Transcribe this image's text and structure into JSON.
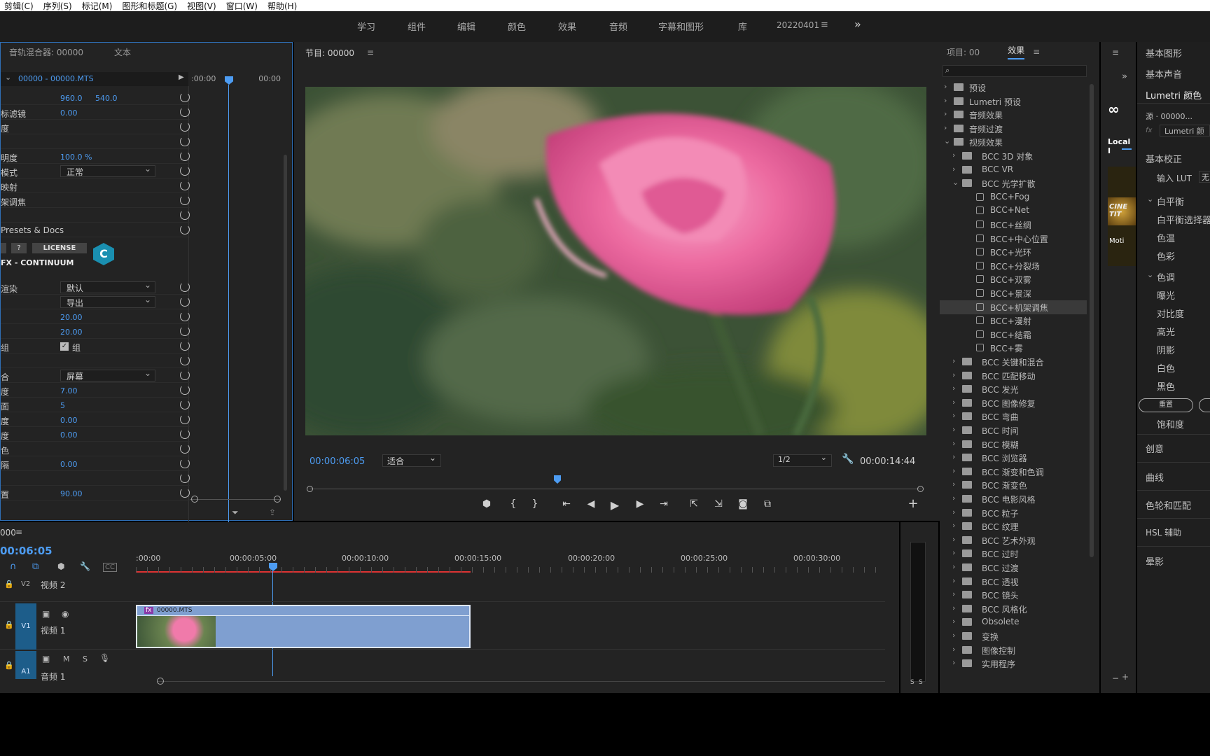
{
  "menubar": [
    "剪辑(C)",
    "序列(S)",
    "标记(M)",
    "图形和标题(G)",
    "视图(V)",
    "窗口(W)",
    "帮助(H)"
  ],
  "workspaces": {
    "tabs": [
      "学习",
      "组件",
      "编辑",
      "颜色",
      "效果",
      "音频",
      "字幕和图形",
      "库"
    ],
    "active": "20220401",
    "more": "»"
  },
  "effect_controls": {
    "tab_mixer": "音轨混合器: 00000",
    "tab_text": "文本",
    "clip_path": "00000 - 00000.MTS",
    "time_start": ":00:00",
    "time_end": "00:00",
    "rows": [
      {
        "label": "",
        "v1": "960.0",
        "v2": "540.0"
      },
      {
        "label": "标滤镜",
        "v1": "0.00"
      },
      {
        "label": "度",
        "v1": ""
      },
      {
        "label": "",
        "v1": ""
      },
      {
        "label": "明度",
        "v1": "100.0 %"
      },
      {
        "label": "模式",
        "sel": "正常"
      },
      {
        "label": "映射",
        "v1": ""
      },
      {
        "label": "架调焦",
        "v1": ""
      },
      {
        "label": "",
        "v1": ""
      },
      {
        "label": "Presets & Docs",
        "v1": ""
      }
    ],
    "license_q": "?",
    "license": "LICENSE",
    "brand": "FX - CONTINUUM",
    "brand_icon": "C",
    "rows2": [
      {
        "label": "渲染",
        "sel": "默认"
      },
      {
        "label": "",
        "sel": "导出"
      },
      {
        "label": "",
        "v1": "20.00"
      },
      {
        "label": "",
        "v1": "20.00"
      },
      {
        "label": "组",
        "check": "组"
      },
      {
        "label": "",
        "v1": ""
      },
      {
        "label": "合",
        "sel": "屏幕"
      },
      {
        "label": "度",
        "v1": "7.00"
      },
      {
        "label": "面",
        "v1": "5"
      },
      {
        "label": "度",
        "v1": "0.00"
      },
      {
        "label": "度",
        "v1": "0.00"
      },
      {
        "label": "色",
        "v1": ""
      },
      {
        "label": "隔",
        "v1": "0.00"
      },
      {
        "label": "",
        "v1": ""
      },
      {
        "label": "置",
        "v1": "90.00"
      }
    ]
  },
  "program": {
    "title": "节目: 00000",
    "timecode": "00:00:06:05",
    "fit": "适合",
    "resolution": "1/2",
    "duration": "00:00:14:44"
  },
  "project_panel": {
    "tab_project": "项目: 00",
    "tab_effects": "效果",
    "items": [
      {
        "name": "预设",
        "level": 0,
        "type": "folder",
        "open": false
      },
      {
        "name": "Lumetri 预设",
        "level": 0,
        "type": "folder",
        "open": false
      },
      {
        "name": "音频效果",
        "level": 0,
        "type": "folder",
        "open": false
      },
      {
        "name": "音频过渡",
        "level": 0,
        "type": "folder",
        "open": false
      },
      {
        "name": "视频效果",
        "level": 0,
        "type": "folder",
        "open": true
      },
      {
        "name": "BCC 3D 对象",
        "level": 1,
        "type": "folder",
        "open": false
      },
      {
        "name": "BCC VR",
        "level": 1,
        "type": "folder",
        "open": false
      },
      {
        "name": "BCC 光学扩散",
        "level": 1,
        "type": "folder",
        "open": true
      },
      {
        "name": "BCC+Fog",
        "level": 2,
        "type": "fx"
      },
      {
        "name": "BCC+Net",
        "level": 2,
        "type": "fx"
      },
      {
        "name": "BCC+丝绸",
        "level": 2,
        "type": "fx"
      },
      {
        "name": "BCC+中心位置",
        "level": 2,
        "type": "fx"
      },
      {
        "name": "BCC+光环",
        "level": 2,
        "type": "fx"
      },
      {
        "name": "BCC+分裂场",
        "level": 2,
        "type": "fx"
      },
      {
        "name": "BCC+双雾",
        "level": 2,
        "type": "fx"
      },
      {
        "name": "BCC+景深",
        "level": 2,
        "type": "fx"
      },
      {
        "name": "BCC+机架调焦",
        "level": 2,
        "type": "fx",
        "selected": true
      },
      {
        "name": "BCC+漫射",
        "level": 2,
        "type": "fx"
      },
      {
        "name": "BCC+结霜",
        "level": 2,
        "type": "fx"
      },
      {
        "name": "BCC+雾",
        "level": 2,
        "type": "fx"
      },
      {
        "name": "BCC 关键和混合",
        "level": 1,
        "type": "folder",
        "open": false
      },
      {
        "name": "BCC 匹配移动",
        "level": 1,
        "type": "folder",
        "open": false
      },
      {
        "name": "BCC 发光",
        "level": 1,
        "type": "folder",
        "open": false
      },
      {
        "name": "BCC 图像修复",
        "level": 1,
        "type": "folder",
        "open": false
      },
      {
        "name": "BCC 弯曲",
        "level": 1,
        "type": "folder",
        "open": false
      },
      {
        "name": "BCC 时间",
        "level": 1,
        "type": "folder",
        "open": false
      },
      {
        "name": "BCC 模糊",
        "level": 1,
        "type": "folder",
        "open": false
      },
      {
        "name": "BCC 浏览器",
        "level": 1,
        "type": "folder",
        "open": false
      },
      {
        "name": "BCC 渐变和色调",
        "level": 1,
        "type": "folder",
        "open": false
      },
      {
        "name": "BCC 渐变色",
        "level": 1,
        "type": "folder",
        "open": false
      },
      {
        "name": "BCC 电影风格",
        "level": 1,
        "type": "folder",
        "open": false
      },
      {
        "name": "BCC 粒子",
        "level": 1,
        "type": "folder",
        "open": false
      },
      {
        "name": "BCC 纹理",
        "level": 1,
        "type": "folder",
        "open": false
      },
      {
        "name": "BCC 艺术外观",
        "level": 1,
        "type": "folder",
        "open": false
      },
      {
        "name": "BCC 过时",
        "level": 1,
        "type": "folder",
        "open": false
      },
      {
        "name": "BCC 过渡",
        "level": 1,
        "type": "folder",
        "open": false
      },
      {
        "name": "BCC 透视",
        "level": 1,
        "type": "folder",
        "open": false
      },
      {
        "name": "BCC 镜头",
        "level": 1,
        "type": "folder",
        "open": false
      },
      {
        "name": "BCC 风格化",
        "level": 1,
        "type": "folder",
        "open": false
      },
      {
        "name": "Obsolete",
        "level": 1,
        "type": "folder",
        "open": false
      },
      {
        "name": "变换",
        "level": 1,
        "type": "folder",
        "open": false
      },
      {
        "name": "图像控制",
        "level": 1,
        "type": "folder",
        "open": false
      },
      {
        "name": "实用程序",
        "level": 1,
        "type": "folder",
        "open": false
      }
    ]
  },
  "narrow_panel": {
    "local_label": "Local I",
    "thumb_text": "CINE TIT",
    "thumb_sub": "Moti"
  },
  "right_panel": {
    "essential_graphics": "基本图形",
    "essential_sound": "基本声音",
    "lumetri": "Lumetri 颜色",
    "source": "源 · 00000...",
    "fx_label": "fx",
    "lumetri_short": "Lumetri 颜",
    "basic_correction": "基本校正",
    "input_lut": "输入 LUT",
    "lut_value": "无",
    "white_balance": "白平衡",
    "wb_selector": "白平衡选择器",
    "temperature": "色温",
    "tint": "色彩",
    "tone": "色调",
    "exposure": "曝光",
    "contrast": "对比度",
    "highlights": "高光",
    "shadows": "阴影",
    "whites": "白色",
    "blacks": "黑色",
    "reset_btn": "重置",
    "saturation": "饱和度",
    "creative": "创意",
    "curves": "曲线",
    "color_wheels": "色轮和匹配",
    "hsl": "HSL 辅助",
    "vignette": "晕影"
  },
  "timeline": {
    "seq_name": "000",
    "timecode": "00:06:05",
    "ruler": [
      ":00:00",
      "00:00:05:00",
      "00:00:10:00",
      "00:00:15:00",
      "00:00:20:00",
      "00:00:25:00",
      "00:00:30:00"
    ],
    "tracks": {
      "v2_id": "V2",
      "v2_name": "视频 2",
      "v1_id": "V1",
      "v1_name": "视频 1",
      "a1_id": "A1",
      "a1_name": "音频 1",
      "a1_m": "M",
      "a1_s": "S"
    },
    "clip_name": "00000.MTS",
    "clip_fx": "fx",
    "meter_labels": [
      "S",
      "S"
    ]
  },
  "colors": {
    "accent": "#4d9cf2",
    "panel": "#232323",
    "clip": "#7f9fd0",
    "track_header": "#1d5d8a"
  }
}
